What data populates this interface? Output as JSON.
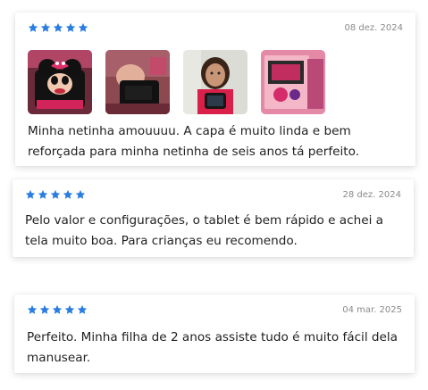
{
  "colors": {
    "star": "#2a7de1",
    "date": "#8a8a8a",
    "text": "#1f1f1f"
  },
  "reviews": [
    {
      "rating": 5,
      "date": "08 dez. 2024",
      "photos": [
        "mickey-case-photo",
        "case-back-photo",
        "child-with-tablet-photo",
        "packaging-photo"
      ],
      "text": "Minha netinha amouuuu. A capa é muito linda e bem reforçada para minha netinha de seis anos tá perfeito."
    },
    {
      "rating": 5,
      "date": "28 dez. 2024",
      "text": "Pelo valor e configurações, o tablet é bem rápido e achei a tela muito boa. Para crianças eu recomendo."
    },
    {
      "rating": 5,
      "date": "04 mar. 2025",
      "text": "Perfeito. Minha filha de 2 anos assiste tudo é muito fácil dela manusear."
    }
  ]
}
